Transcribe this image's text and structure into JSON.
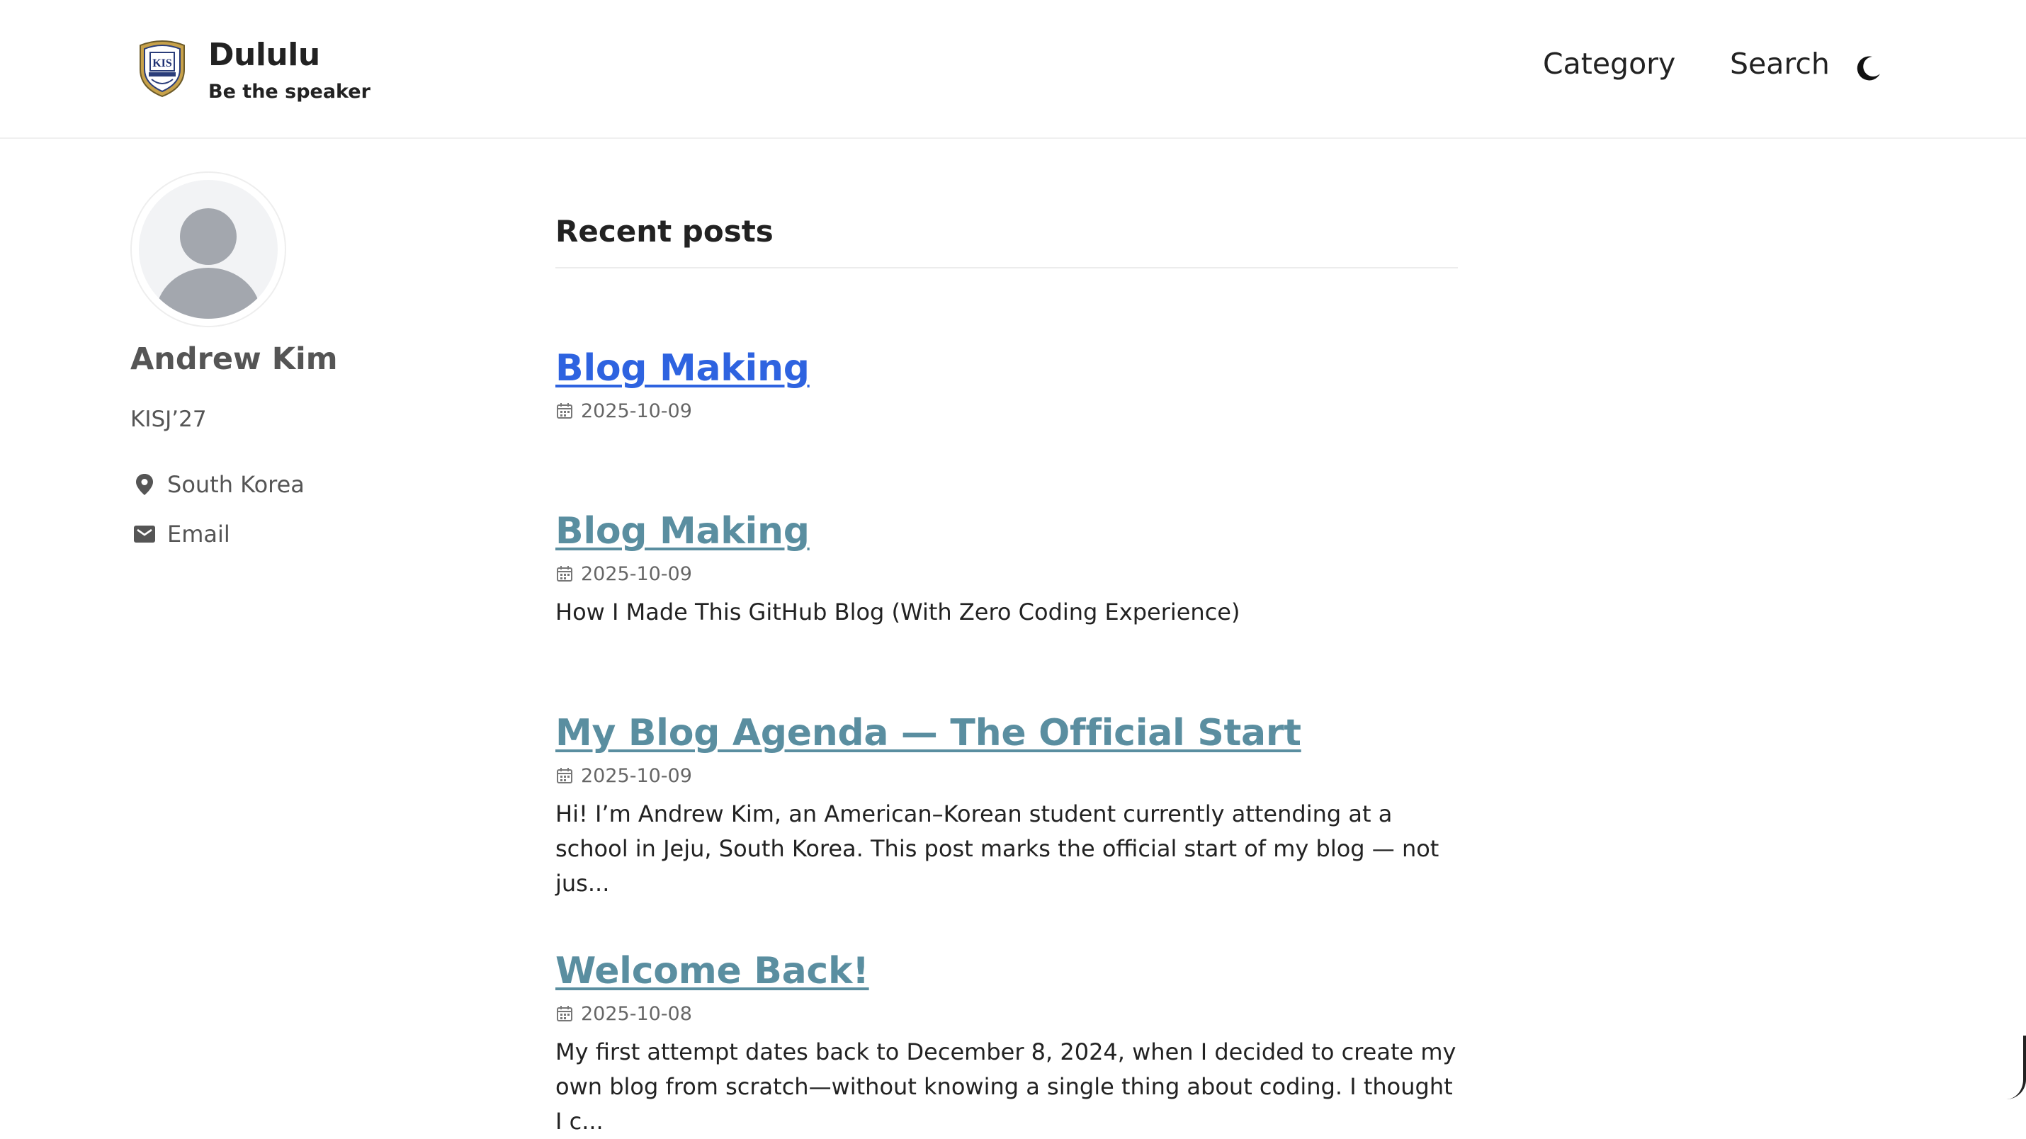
{
  "header": {
    "site_title": "Dululu",
    "site_subtitle": "Be the speaker",
    "logo_text": "KIS",
    "nav": [
      {
        "label": "Category"
      },
      {
        "label": "Search"
      }
    ],
    "theme_toggle_icon": "moon-icon"
  },
  "sidebar": {
    "avatar_icon": "default-user-icon",
    "name": "Andrew Kim",
    "bio": "KISJ’27",
    "location": "South Korea",
    "location_icon": "map-pin-icon",
    "email_label": "Email",
    "email_icon": "envelope-icon"
  },
  "main": {
    "title": "Recent posts",
    "posts": [
      {
        "title": "Blog Making",
        "date": "2025-10-09",
        "excerpt": ""
      },
      {
        "title": "Blog Making",
        "date": "2025-10-09",
        "excerpt": "How I Made This GitHub Blog (With Zero Coding Experience)"
      },
      {
        "title": "My Blog Agenda — The Official Start",
        "date": "2025-10-09",
        "excerpt": "Hi! I’m Andrew Kim, an American–Korean student currently attending at a school in Jeju, South Korea. This post marks the official start of my blog — not jus..."
      },
      {
        "title": "Welcome Back!",
        "date": "2025-10-08",
        "excerpt": "My first attempt dates back to December 8, 2024, when I decided to create my own blog from scratch—without knowing a single thing about coding. I thought I c..."
      }
    ]
  },
  "colors": {
    "link_active": "#2e63e0",
    "link_visited": "#5a8ea0",
    "text": "#222222",
    "muted": "#555555"
  }
}
